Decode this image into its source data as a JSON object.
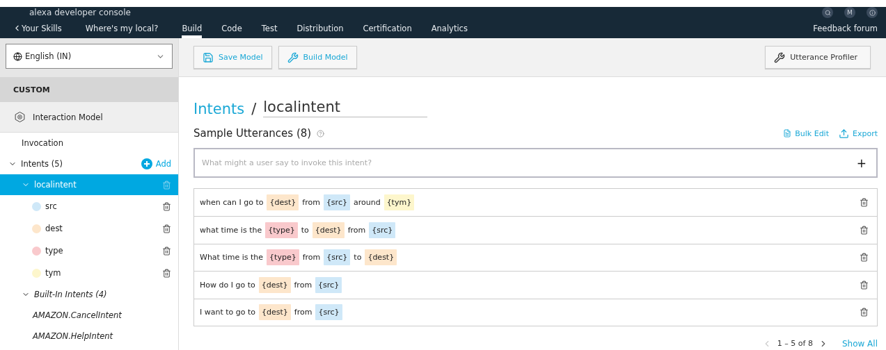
{
  "header": {
    "title": "alexa developer console",
    "avatar": "M"
  },
  "nav": {
    "back": "Your Skills",
    "skill": "Where's my local?",
    "tabs": [
      {
        "label": "Build",
        "selected": true
      },
      {
        "label": "Code",
        "selected": false
      },
      {
        "label": "Test",
        "selected": false
      },
      {
        "label": "Distribution",
        "selected": false
      },
      {
        "label": "Certification",
        "selected": false
      },
      {
        "label": "Analytics",
        "selected": false
      }
    ],
    "feedback": "Feedback forum"
  },
  "sidebar": {
    "language": "English (IN)",
    "section": "CUSTOM",
    "model": "Interaction Model",
    "invocation": "Invocation",
    "intents": {
      "label": "Intents (5)",
      "add": "Add",
      "expanded": true,
      "items": [
        {
          "label": "localintent",
          "selected": true,
          "expanded": true,
          "children": [
            {
              "label": "src",
              "color": "#cfe8f8"
            },
            {
              "label": "dest",
              "color": "#fde6cb"
            },
            {
              "label": "type",
              "color": "#f9c9cc"
            },
            {
              "label": "tym",
              "color": "#fdf6cc"
            }
          ]
        }
      ]
    },
    "builtin": {
      "label": "Built-In Intents (4)",
      "expanded": true,
      "items": [
        "AMAZON.CancelIntent",
        "AMAZON.HelpIntent"
      ]
    }
  },
  "toolbar": {
    "buttons": [
      {
        "label": "Save Model",
        "kind": "save"
      },
      {
        "label": "Build Model",
        "kind": "build"
      }
    ],
    "profiler": "Utterance Profiler"
  },
  "breadcrumb": {
    "parent": "Intents",
    "separator": "/",
    "current": "localintent"
  },
  "utterances": {
    "title": "Sample Utterances (8)",
    "bulk_edit": "Bulk Edit",
    "export": "Export",
    "placeholder": "What might a user say to invoke this intent?",
    "add": "+",
    "rows": [
      [
        {
          "kind": "text",
          "text": "when can I go to"
        },
        {
          "kind": "slot",
          "text": "{dest}",
          "color": "#fde6cb"
        },
        {
          "kind": "text",
          "text": "from"
        },
        {
          "kind": "slot",
          "text": "{src}",
          "color": "#cfe8f8"
        },
        {
          "kind": "text",
          "text": "around"
        },
        {
          "kind": "slot",
          "text": "{tym}",
          "color": "#fdf6cc"
        }
      ],
      [
        {
          "kind": "text",
          "text": "what time is the"
        },
        {
          "kind": "slot",
          "text": "{type}",
          "color": "#f9c9cc"
        },
        {
          "kind": "text",
          "text": "to"
        },
        {
          "kind": "slot",
          "text": "{dest}",
          "color": "#fde6cb"
        },
        {
          "kind": "text",
          "text": "from"
        },
        {
          "kind": "slot",
          "text": "{src}",
          "color": "#cfe8f8"
        }
      ],
      [
        {
          "kind": "text",
          "text": "What time is the"
        },
        {
          "kind": "slot",
          "text": "{type}",
          "color": "#f9c9cc"
        },
        {
          "kind": "text",
          "text": "from"
        },
        {
          "kind": "slot",
          "text": "{src}",
          "color": "#cfe8f8"
        },
        {
          "kind": "text",
          "text": "to"
        },
        {
          "kind": "slot",
          "text": "{dest}",
          "color": "#fde6cb"
        }
      ],
      [
        {
          "kind": "text",
          "text": "How do I go to"
        },
        {
          "kind": "slot",
          "text": "{dest}",
          "color": "#fde6cb"
        },
        {
          "kind": "text",
          "text": "from"
        },
        {
          "kind": "slot",
          "text": "{src}",
          "color": "#cfe8f8"
        }
      ],
      [
        {
          "kind": "text",
          "text": "I want to go to"
        },
        {
          "kind": "slot",
          "text": "{dest}",
          "color": "#fde6cb"
        },
        {
          "kind": "text",
          "text": "from"
        },
        {
          "kind": "slot",
          "text": "{src}",
          "color": "#cfe8f8"
        }
      ]
    ],
    "pagination": "1 – 5 of 8",
    "show_all": "Show All"
  }
}
